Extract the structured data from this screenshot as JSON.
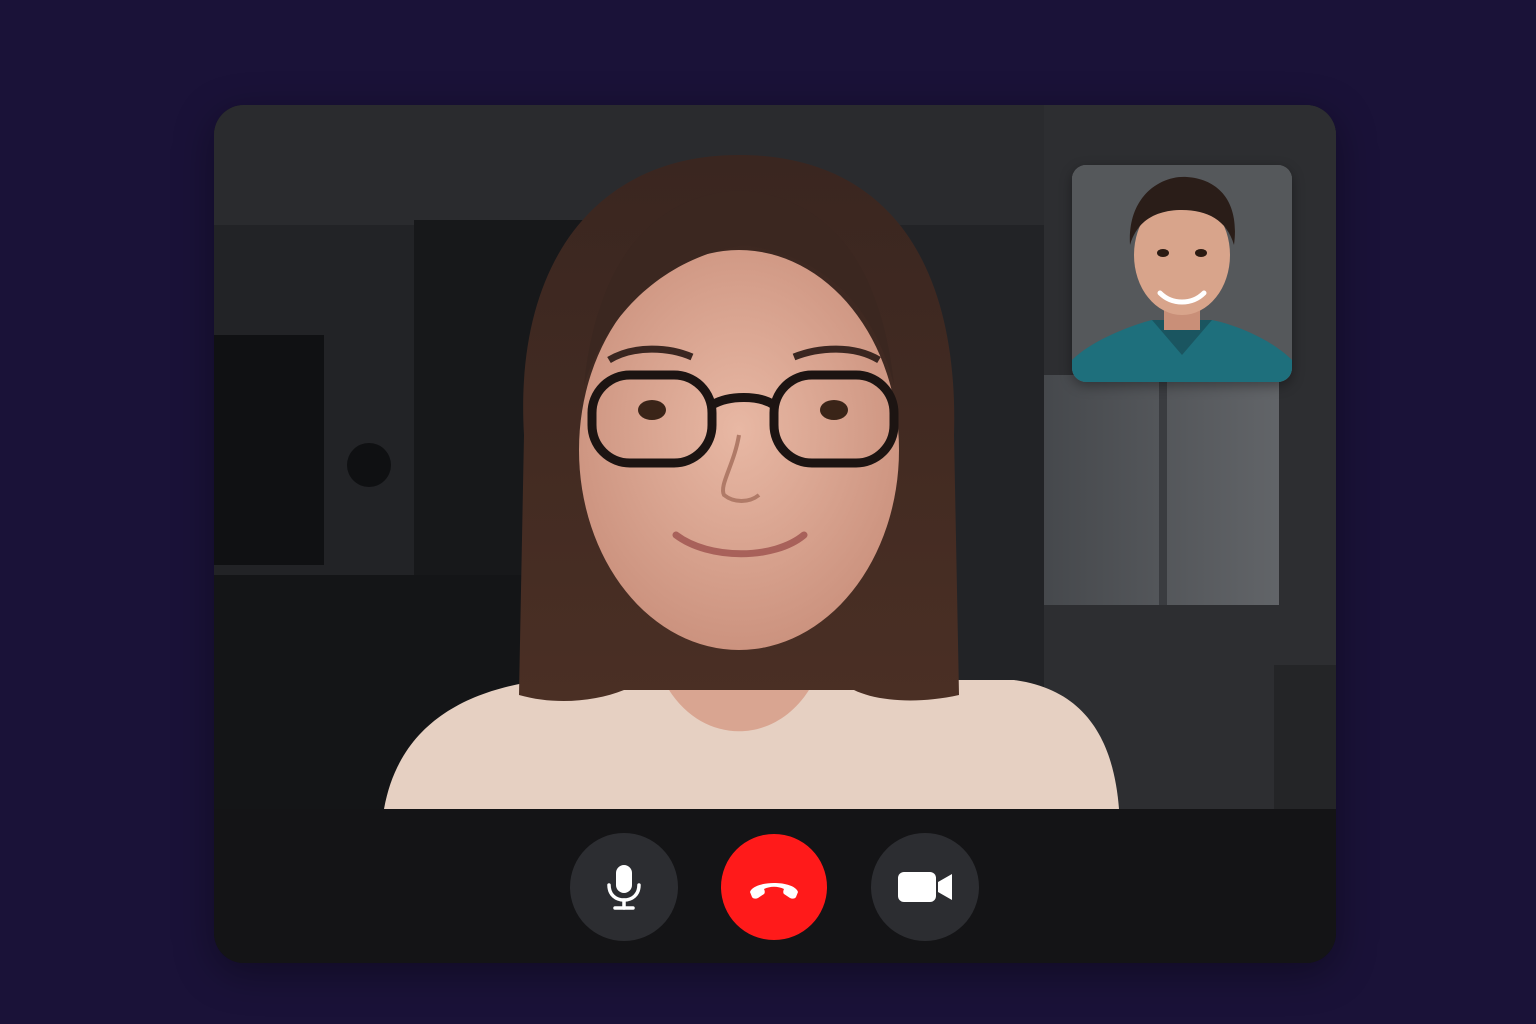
{
  "call": {
    "main_participant": {
      "video": "remote-participant-video"
    },
    "self_view": {
      "video": "self-view-video"
    }
  },
  "controls": [
    {
      "id": "mute",
      "icon": "microphone-icon",
      "color": "#2c2d31"
    },
    {
      "id": "end_call",
      "icon": "phone-hangup-icon",
      "color": "#ff1a1a"
    },
    {
      "id": "camera",
      "icon": "video-camera-icon",
      "color": "#2c2d31"
    }
  ],
  "colors": {
    "background": "#1a1238",
    "window": "#141416",
    "end_call": "#ff1a1a",
    "button": "#2c2d31"
  }
}
